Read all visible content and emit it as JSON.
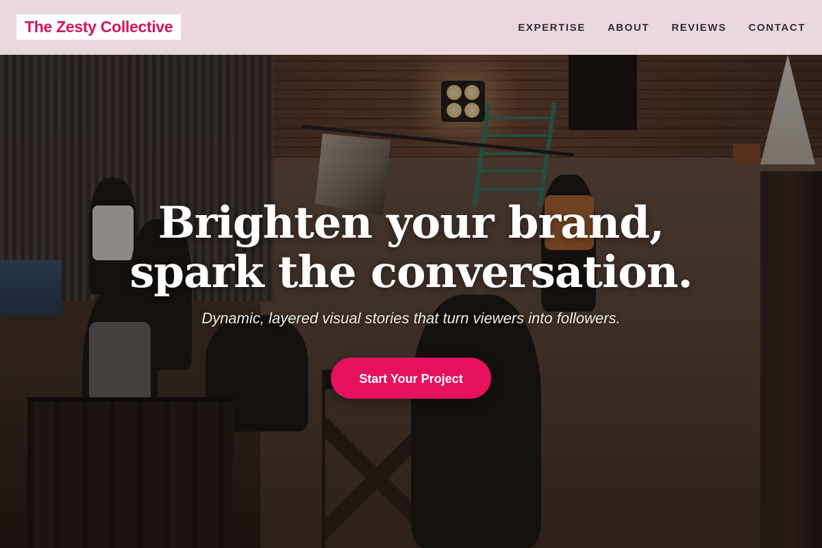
{
  "header": {
    "brand": "The Zesty Collective",
    "nav": [
      {
        "label": "EXPERTISE"
      },
      {
        "label": "ABOUT"
      },
      {
        "label": "REVIEWS"
      },
      {
        "label": "CONTACT"
      }
    ]
  },
  "hero": {
    "headline_line1": "Brighten your brand,",
    "headline_line2": "spark the conversation.",
    "subheadline": "Dynamic, layered visual stories that turn viewers into followers.",
    "cta_label": "Start Your Project",
    "background_description_icon": "film-set-photo"
  },
  "colors": {
    "brand_pink": "#d6135f",
    "cta_pink": "#e5115f",
    "header_bg": "#fce8ee",
    "nav_text": "#2f2d3a"
  }
}
